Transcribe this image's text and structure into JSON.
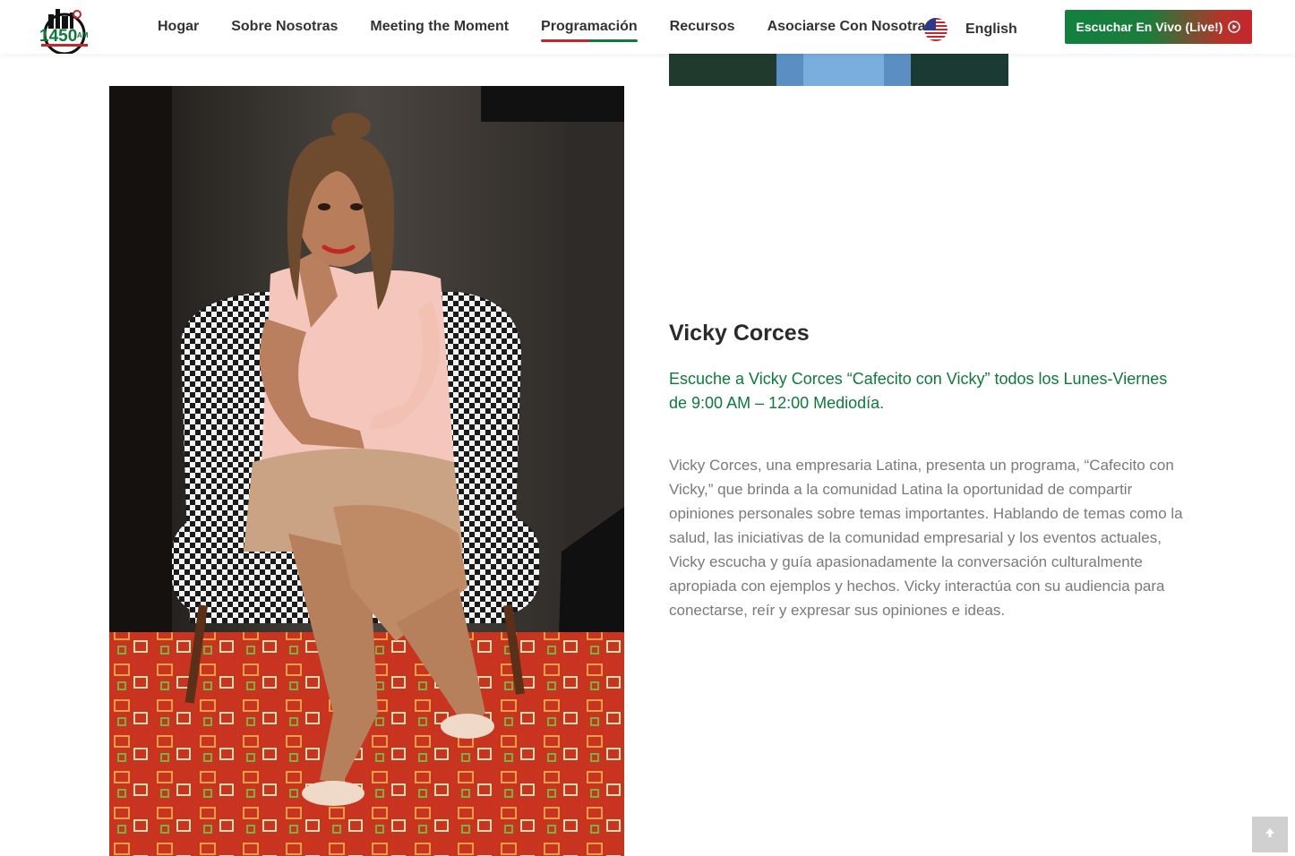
{
  "header": {
    "logo_alt": "1450 AM",
    "nav": [
      {
        "label": "Hogar"
      },
      {
        "label": "Sobre Nosotras"
      },
      {
        "label": "Meeting the Moment"
      },
      {
        "label": "Programación",
        "active": true
      },
      {
        "label": "Recursos"
      },
      {
        "label": "Asociarse Con Nosotras"
      }
    ],
    "language": {
      "label": "English",
      "flag_icon": "us-flag-icon"
    },
    "live_button": {
      "label": "Escuchar En Vivo (Live!)",
      "icon": "play-circle-icon"
    }
  },
  "content": {
    "host_name": "Vicky Corces",
    "schedule": "Escuche a Vicky Corces “Cafecito con Vicky” todos los Lunes-Viernes de 9:00 AM – 12:00 Mediodía.",
    "bio": "Vicky Corces, una empresaria Latina, presenta un programa, “Cafecito con Vicky,” que brinda a la comunidad Latina la oportunidad de compartir opiniones personales sobre temas importantes. Hablando de temas como la salud, las iniciativas de la comunidad empresarial y los eventos actuales, Vicky escucha y guía apasionadamente la conversación culturalmente apropiada con ejemplos y hechos. Vicky interactúa con su audiencia para conectarse, reír y expresar sus opiniones e ideas."
  },
  "colors": {
    "brand_green": "#0d7a3a",
    "brand_red": "#c4262e",
    "body_text": "#7a7a7a"
  },
  "scroll_top_icon": "arrow-up-icon"
}
